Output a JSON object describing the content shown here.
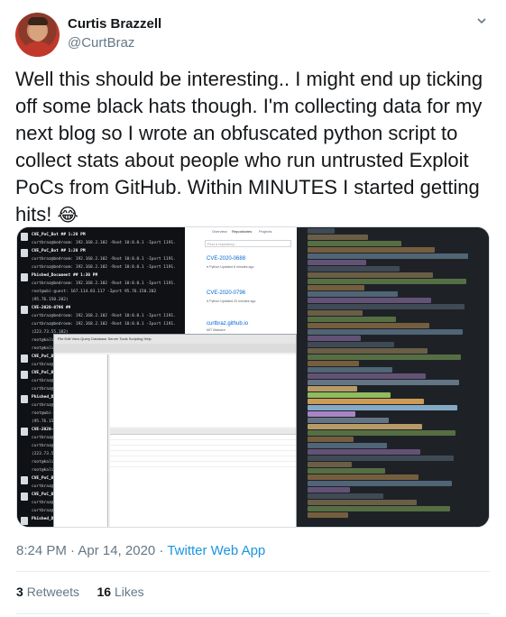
{
  "author": {
    "display_name": "Curtis Brazzell",
    "handle": "@CurtBraz"
  },
  "tweet": {
    "text": "Well this should be interesting.. I might end up ticking off some black hats though. I'm collecting data for my next blog so I wrote an obfuscated python script to collect stats about people who run untrusted Exploit PoCs from GitHub. Within MINUTES I started getting hits!",
    "emoji": "😂",
    "time": "8:24 PM · Apr 14, 2020",
    "separator": " · ",
    "client": "Twitter Web App"
  },
  "stats": {
    "retweets_count": "3",
    "retweets_label": "Retweets",
    "likes_count": "16",
    "likes_label": "Likes"
  },
  "media": {
    "github": {
      "search_placeholder": "Find a repository...",
      "repos": [
        {
          "name": "CVE-2020-0688",
          "meta": "● Python   Updated 6 minutes ago"
        },
        {
          "name": "CVE-2020-0796",
          "meta": "● Python   Updated 20 minutes ago"
        },
        {
          "name": "curtbraz.github.io",
          "meta": "MIT Malware"
        }
      ]
    },
    "terminal_rows": [
      "CVE_PoC_Bot ##  1:28 PM",
      "curtbraz@bedroom: 192.168.2.102 -Root 10:0.0.1 -Iport 1191.",
      "CVE_PoC_Bot ##  1:28 PM",
      "curtbraz@bedroom: 192.168.2.102 -Root 10:0.0.1 -Iport 1191.",
      "curtbraz@bedroom: 192.168.2.102 -Root 10:0.0.1 -Iport 1191.",
      "Phished_Document ##  1:30 PM",
      "curtbraz@bedroom: 192.168.2.102 -Root 10:0.0.1 -Iport 1191.",
      "root@ubi-guest: 167.114.83.117 -Iport 95.76.150.202",
      "(95.76.150.202)",
      "CVE-2020-0796 ##",
      "curtbraz@bedroom: 192.168.2.102 -Root 10:0.0.1 -Iport 1191.",
      "curtbraz@bedroom: 192.168.2.102 -Root 10:0.0.1 -Iport 1191.",
      "(223.73.55.182)",
      "root@kali: 192.168.233.129 (77.18.53.24)",
      "root@kali: 192.168.233.129 192.168.233.130 (77.18.53.24)"
    ],
    "db": {
      "menubar": "File  Edit  View  Query  Database  Server  Tools  Scripting  Help"
    }
  },
  "colors": {
    "link": "#1b95e0",
    "muted": "#657786",
    "text": "#14171a"
  }
}
